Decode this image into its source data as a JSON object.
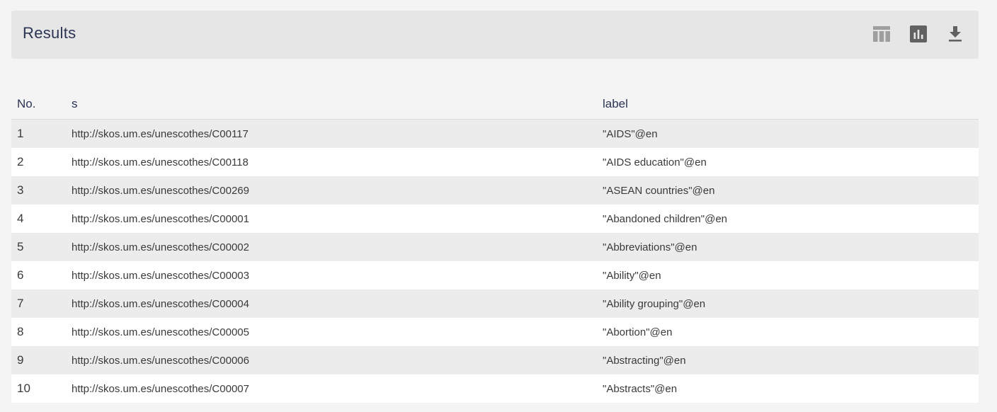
{
  "header": {
    "title": "Results",
    "tools": [
      {
        "name": "table-view-icon"
      },
      {
        "name": "chart-view-icon"
      },
      {
        "name": "download-icon"
      }
    ]
  },
  "colors": {
    "header_bg": "#e6e6e6",
    "title_color": "#2b3553",
    "row_odd": "#ececec",
    "row_even": "#ffffff",
    "table_icon_color": "#9e9e9e",
    "chart_icon_color": "#616161",
    "download_icon_color": "#616161"
  },
  "table": {
    "columns": [
      "No.",
      "s",
      "label"
    ],
    "rows": [
      [
        "1",
        "http://skos.um.es/unescothes/C00117",
        "\"AIDS\"@en"
      ],
      [
        "2",
        "http://skos.um.es/unescothes/C00118",
        "\"AIDS education\"@en"
      ],
      [
        "3",
        "http://skos.um.es/unescothes/C00269",
        "\"ASEAN countries\"@en"
      ],
      [
        "4",
        "http://skos.um.es/unescothes/C00001",
        "\"Abandoned children\"@en"
      ],
      [
        "5",
        "http://skos.um.es/unescothes/C00002",
        "\"Abbreviations\"@en"
      ],
      [
        "6",
        "http://skos.um.es/unescothes/C00003",
        "\"Ability\"@en"
      ],
      [
        "7",
        "http://skos.um.es/unescothes/C00004",
        "\"Ability grouping\"@en"
      ],
      [
        "8",
        "http://skos.um.es/unescothes/C00005",
        "\"Abortion\"@en"
      ],
      [
        "9",
        "http://skos.um.es/unescothes/C00006",
        "\"Abstracting\"@en"
      ],
      [
        "10",
        "http://skos.um.es/unescothes/C00007",
        "\"Abstracts\"@en"
      ]
    ]
  }
}
